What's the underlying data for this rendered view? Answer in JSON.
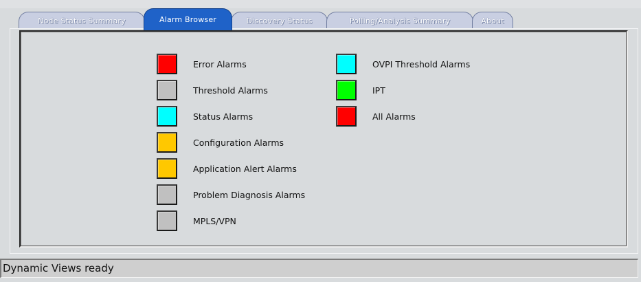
{
  "tabs": [
    {
      "label": "Node Status Summary",
      "active": false
    },
    {
      "label": "Alarm Browser",
      "active": true
    },
    {
      "label": "Discovery Status",
      "active": false
    },
    {
      "label": "Polling/Analysis Summary",
      "active": false
    },
    {
      "label": "About",
      "active": false
    }
  ],
  "alarms_left": [
    {
      "label": "Error Alarms",
      "color": "#ff0000"
    },
    {
      "label": "Threshold Alarms",
      "color": "#c0c0c0"
    },
    {
      "label": "Status Alarms",
      "color": "#00ffff"
    },
    {
      "label": "Configuration Alarms",
      "color": "#ffc800"
    },
    {
      "label": "Application Alert Alarms",
      "color": "#ffc800"
    },
    {
      "label": "Problem Diagnosis Alarms",
      "color": "#c0c0c0"
    },
    {
      "label": "MPLS/VPN",
      "color": "#c0c0c0"
    }
  ],
  "alarms_right": [
    {
      "label": "OVPI Threshold Alarms",
      "color": "#00ffff"
    },
    {
      "label": "IPT",
      "color": "#00ff00"
    },
    {
      "label": "All Alarms",
      "color": "#ff0000"
    }
  ],
  "status_bar": {
    "text": "Dynamic Views ready"
  }
}
